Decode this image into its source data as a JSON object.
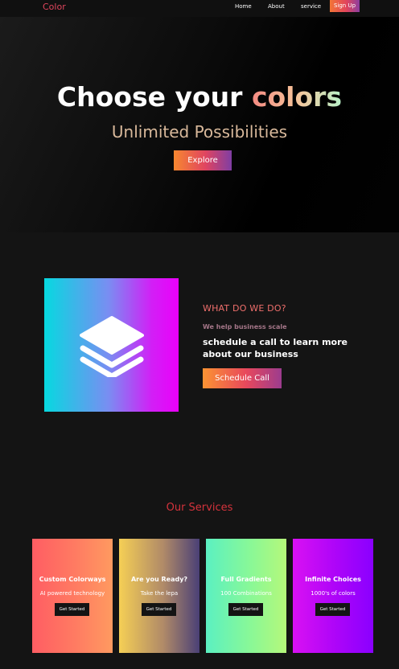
{
  "nav": {
    "logo": "Color",
    "links": [
      "Home",
      "About",
      "service"
    ],
    "signup": "Sign Up"
  },
  "hero": {
    "title_white": "Choose your",
    "title_color": "colors",
    "subtitle": "Unlimited Possibilities",
    "button": "Explore"
  },
  "about": {
    "icon": "layers-icon",
    "heading": "WHAT DO WE DO?",
    "tagline": "We help business scale",
    "text": "schedule a call to learn more about our business",
    "button": "Schedule Call"
  },
  "services": {
    "title": "Our Services",
    "cards": [
      {
        "title": "Custom Colorways",
        "subtitle": "AI powered technology",
        "button": "Get Started"
      },
      {
        "title": "Are you Ready?",
        "subtitle": "Take the lepa",
        "button": "Get Started"
      },
      {
        "title": "Full Gradients",
        "subtitle": "100 Combinations",
        "button": "Get Started"
      },
      {
        "title": "Infinite Choices",
        "subtitle": "1000's of colors",
        "button": "Get Started"
      }
    ]
  },
  "colors": {
    "accent_red": "#e0455d",
    "background": "#141414"
  }
}
